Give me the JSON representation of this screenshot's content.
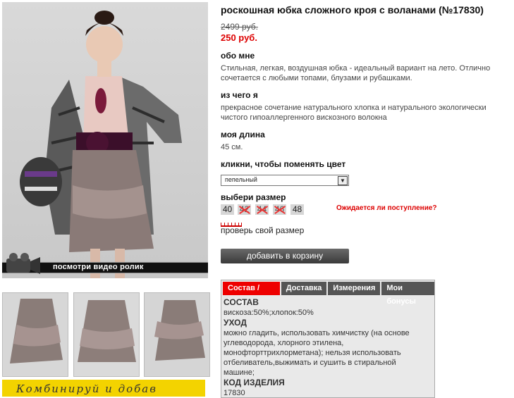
{
  "product": {
    "title": "роскошная юбка сложного кроя с воланами (№17830)",
    "old_price": "2499 руб.",
    "new_price": "250 руб."
  },
  "sections": {
    "about_title": "обо мне",
    "about_text_1": "Стильная, легкая, воздушная юбка - идеальный вариант на лето. Отлично",
    "about_text_2": "сочетается с любыми топами, блузами и рубашками.",
    "material_title": "из чего я",
    "material_text_1": "прекрасное сочетание натурального хлопка и натурального экологически",
    "material_text_2": "чистого гипоаллергенного вискозного волокна",
    "length_title": "моя длина",
    "length_text": "45 см.",
    "color_title": "кликни, чтобы поменять цвет",
    "size_title": "выбери размер"
  },
  "color_select": {
    "selected": "пепельный"
  },
  "sizes": [
    {
      "label": "40",
      "available": true
    },
    {
      "label": "42",
      "available": false
    },
    {
      "label": "44",
      "available": false
    },
    {
      "label": "46",
      "available": false
    },
    {
      "label": "48",
      "available": true
    }
  ],
  "expected_link": "Ожидается ли поступление?",
  "check_size_link": "проверь свой размер",
  "cart_button": "добавить в корзину",
  "video_label": "посмотри видео ролик",
  "banner_text": "Комбинируй и добав",
  "tabs": [
    "Состав / Уход",
    "Доставка",
    "Измерения",
    "Мои бонусы"
  ],
  "panel": {
    "composition_title": "СОСТАВ",
    "composition_text": "вискоза:50%;хлопок:50%",
    "care_title": "УХОД",
    "care_text_1": "можно гладить, использовать химчистку (на основе",
    "care_text_2": "углеводорода, хлорного этилена,",
    "care_text_3": "монофторттрихлорметана); нельзя использовать",
    "care_text_4": "отбеливатель,выжимать и сушить в стиральной",
    "care_text_5": "машине;",
    "code_title": "КОД ИЗДЕЛИЯ",
    "code_text": "17830"
  },
  "colors": {
    "accent_red": "#dd0000",
    "tab_gray": "#555555",
    "banner_yellow": "#f3d300"
  }
}
